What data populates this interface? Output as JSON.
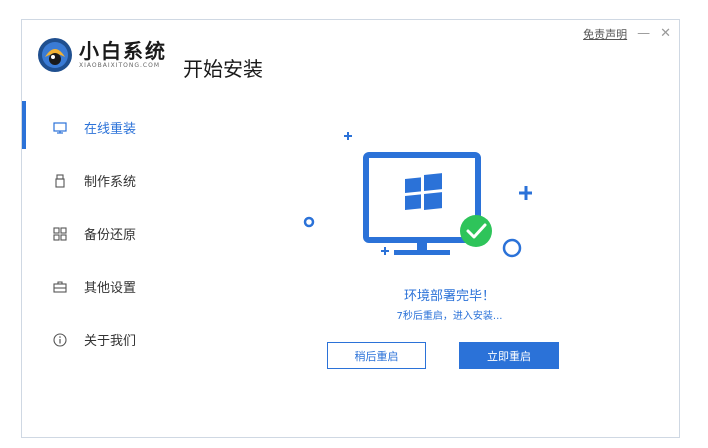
{
  "window": {
    "disclaimer": "免责声明",
    "minimize": "—",
    "close": "✕"
  },
  "brand": {
    "name": "小白系统",
    "subtitle": "XIAOBAIXITONG.COM"
  },
  "page": {
    "title": "开始安装"
  },
  "sidebar": {
    "items": [
      {
        "label": "在线重装",
        "icon": "monitor-icon",
        "active": true
      },
      {
        "label": "制作系统",
        "icon": "usb-icon",
        "active": false
      },
      {
        "label": "备份还原",
        "icon": "grid-icon",
        "active": false
      },
      {
        "label": "其他设置",
        "icon": "briefcase-icon",
        "active": false
      },
      {
        "label": "关于我们",
        "icon": "info-icon",
        "active": false
      }
    ]
  },
  "status": {
    "title": "环境部署完毕！",
    "countdown": "7秒后重启，进入安装..."
  },
  "actions": {
    "later_label": "稍后重启",
    "now_label": "立即重启"
  },
  "colors": {
    "accent": "#2b72d8",
    "success": "#2ec45a"
  }
}
